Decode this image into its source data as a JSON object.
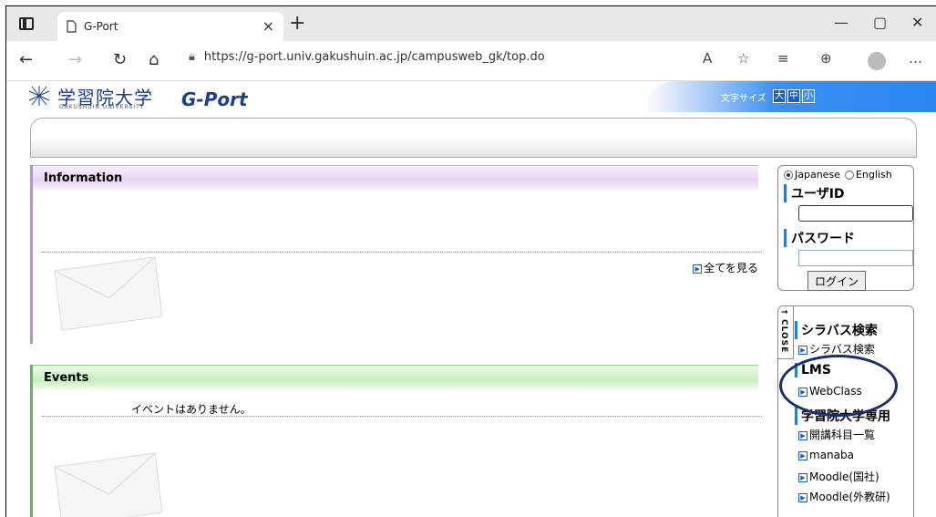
{
  "browser": {
    "tab_title": "G-Port",
    "url": "https://g-port.univ.gakushuin.ac.jp/campusweb_gk/top.do"
  },
  "header": {
    "logo_jp": "学習院大学",
    "logo_en": "GAKUSHUIN UNIVERSITY",
    "gport": "G-Port",
    "font_size_label": "文字サイズ",
    "font_large": "大",
    "font_medium": "中",
    "font_small": "小"
  },
  "information": {
    "title": "Information",
    "view_all": "全てを見る"
  },
  "events": {
    "title": "Events",
    "empty_text": "イベントはありません。"
  },
  "login": {
    "lang_japanese": "Japanese",
    "lang_english": "English",
    "userid_label": "ユーザID",
    "password_label": "パスワード",
    "login_button": "ログイン"
  },
  "side_menu": {
    "close_label": "CLOSE",
    "syllabus_head": "シラバス検索",
    "syllabus_link": "シラバス検索",
    "lms_head": "LMS",
    "webclass_link": "WebClass",
    "gakushuin_head": "学習院大学専用",
    "links": [
      "開講科目一覧",
      "manaba",
      "Moodle(国社)",
      "Moodle(外教研)"
    ]
  },
  "colors": {
    "brand_blue": "#1b3f8e",
    "info_accent": "#b88ed0",
    "events_accent": "#5cb85c",
    "annotation_circle": "#17306a"
  }
}
